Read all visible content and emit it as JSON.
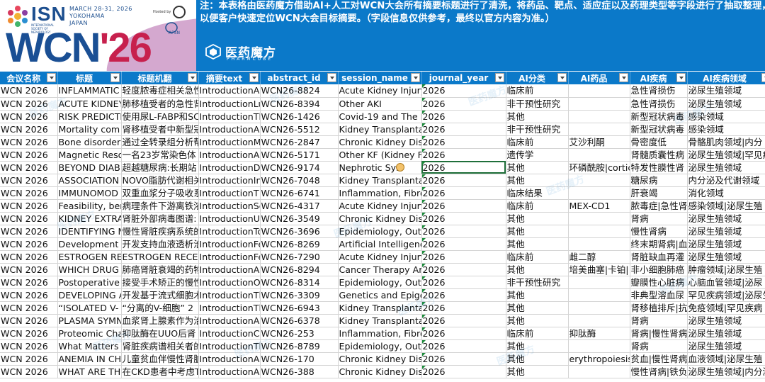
{
  "banner": {
    "isn": "ISN",
    "isn_sub": "INTERNATIONAL SOCIETY OF NEPHROLOGY",
    "event_info": "MARCH 28-31, 2026\nYOKOHAMA\nJAPAN",
    "hosted_by": "Hosted by",
    "host_org": "APSN",
    "wcn": "WCN",
    "wcn_year": "'26",
    "brand_name": "医药魔方",
    "brand_sub": "PHARMCUBE",
    "notice_line1": "注：本表格由医药魔方借助AI+人工对WCN大会所有摘要标题进行了清洗，将药品、靶点、适应症以及药理类型等字段进行了抽取整理，",
    "notice_line2": "以便客户快速定位WCN大会目标摘要。（字段信息仅供参考，最终以官方内容为准。）",
    "watermark": "医药魔方"
  },
  "sheet": {
    "columns": [
      "会议名称",
      "标题",
      "标题机翻",
      "摘要text",
      "abstract_id",
      "session_name",
      "journal_year",
      "AI分类",
      "AI药品",
      "AI疾病",
      "AI疾病领域"
    ],
    "rows": [
      [
        "WCN 2026",
        "INFLAMMATIC",
        "轻度脓毒症相关急性",
        "IntroductionA",
        "WCN26-8824",
        "Acute Kidney Injury",
        "2026",
        "临床前",
        "",
        "急性肾损伤",
        "泌尿生殖领域"
      ],
      [
        "WCN 2026",
        "ACUTE KIDNEY",
        "肺移植受者的急性肾",
        "IntroductionLu",
        "WCN26-8394",
        "Other AKI",
        "2026",
        "非干预性研究",
        "",
        "急性肾损伤",
        "泌尿生殖领域"
      ],
      [
        "WCN 2026",
        "RISK PREDICTI",
        "使用尿L-FABP和SC",
        "IntroductionTh",
        "WCN26-1426",
        "Covid-19 and The K",
        "2026",
        "其他",
        "",
        "新型冠状病毒",
        "感染领域"
      ],
      [
        "WCN 2026",
        "Mortality com",
        "肾移植受者中新型冠",
        "IntroductionA",
        "WCN26-5512",
        "Kidney Transplanta",
        "2026",
        "非干预性研究",
        "",
        "新型冠状病毒",
        "感染领域"
      ],
      [
        "WCN 2026",
        "Bone disorders",
        "通过全转录组分析帮",
        "IntroductionM",
        "WCN26-2847",
        "Chronic Kidney Dis",
        "2026",
        "临床前",
        "艾沙利酮",
        "骨密度低",
        "骨骼肌肉领域|内分"
      ],
      [
        "WCN 2026",
        "Magnetic Reso",
        "一名23岁常染色体",
        "IntroductionA",
        "WCN26-5171",
        "Other KF (Kidney Fa",
        "2026",
        "遗传学",
        "",
        "肾髓质囊性病",
        "泌尿生殖领域|罕见病"
      ],
      [
        "WCN 2026",
        "BEYOND DIAB",
        "超越糖尿病:长期站",
        "IntroductionD",
        "WCN26-9174",
        "Nephrotic Syn",
        "2026",
        "其他",
        "环磷酰胺|cortic",
        "特发性膜性肾",
        "泌尿生殖领域"
      ],
      [
        "WCN 2026",
        "ASSOCIATION",
        "NOVO脂肪代谢相关",
        "IntroductionIn",
        "WCN26-7048",
        "Kidney Transplanta",
        "2026",
        "其他",
        "",
        "糖尿病",
        "内分泌及代谢领域"
      ],
      [
        "WCN 2026",
        "IMMUNOMOD",
        "双重血浆分子吸收系",
        "IntroductionT",
        "WCN26-6741",
        "Inflammation, Fibro",
        "2026",
        "临床结果",
        "",
        "肝衰竭",
        "消化领域"
      ],
      [
        "WCN 2026",
        "Feasibility, ber",
        "病理条件下游离铁浓",
        "IntroductionSe",
        "WCN26-4317",
        "Acute Kidney Injury",
        "2026",
        "临床前",
        "MEX-CD1",
        "脓毒症|急性肾",
        "感染领域|泌尿生殖"
      ],
      [
        "WCN 2026",
        "KIDNEY EXTRA",
        "肾脏外部病毒图谱:",
        "IntroductionU",
        "WCN26-3549",
        "Chronic Kidney Dis",
        "2026",
        "其他",
        "",
        "肾病",
        "泌尿生殖领域"
      ],
      [
        "WCN 2026",
        "IDENTIFYING N",
        "慢性肾脏疾病系统的",
        "IntroductionTc",
        "WCN26-3696",
        "Epidemiology, Outc",
        "2026",
        "其他",
        "",
        "慢性肾病",
        "泌尿生殖领域"
      ],
      [
        "WCN 2026",
        "Development c",
        "开发支持血液透析治",
        "IntroductionFe",
        "WCN26-8269",
        "Artificial Intelligenc",
        "2026",
        "其他",
        "",
        "终末期肾病|血",
        "泌尿生殖领域"
      ],
      [
        "WCN 2026",
        "ESTROGEN RE",
        "ESTROGEN RECEP",
        "IntroductionFe",
        "WCN26-7290",
        "Acute Kidney Injury",
        "2026",
        "临床前",
        "雌二醇",
        "肾脏缺血再灌",
        "泌尿生殖领域"
      ],
      [
        "WCN 2026",
        "WHICH DRUG",
        "肺癌肾脏衰竭的药物",
        "IntroductionA",
        "WCN26-8294",
        "Cancer Therapy An",
        "2026",
        "其他",
        "培美曲塞|卡铂|",
        "非小细胞肺癌",
        "肿瘤领域|泌尿生殖"
      ],
      [
        "WCN 2026",
        "Postoperative",
        "接受手术矫正的慢性",
        "IntroductionO",
        "WCN26-8314",
        "Epidemiology, Outc",
        "2026",
        "非干预性研究",
        "",
        "瓣膜性心脏病",
        "心脑血管领域|泌尿"
      ],
      [
        "WCN 2026",
        "DEVELOPING A",
        "开发基于流式细胞术",
        "IntroductionTl",
        "WCN26-3309",
        "Genetics and Epige",
        "2026",
        "其他",
        "",
        "非典型溶血尿",
        "罕见疾病领域|泌尿生"
      ],
      [
        "WCN 2026",
        "“ISOLATED V-",
        "“分离的V-细胞” 2",
        "IntroductionTl",
        "WCN26-6943",
        "Kidney Transplanta",
        "2026",
        "其他",
        "",
        "肾移植排斥|抗",
        "免疫领域|罕见疾病"
      ],
      [
        "WCN 2026",
        "PLASMA SYMN",
        "血浆肾上腺素作为治",
        "IntroductionA",
        "WCN26-6378",
        "Kidney Transplanta",
        "2026",
        "其他",
        "",
        "肾病",
        "泌尿生殖领域"
      ],
      [
        "WCN 2026",
        "Proteomic Cha",
        "抑肽酶在UUO后肾",
        "IntroductionCl",
        "WCN26-253",
        "Inflammation, Fibro",
        "2026",
        "临床前",
        "抑肽酶",
        "肾病|慢性肾病",
        "泌尿生殖领域"
      ],
      [
        "WCN 2026",
        "What Matters I",
        "肾脏疾病谱相关者的",
        "IntroductionTh",
        "WCN26-8789",
        "Epidemiology, Outc",
        "2026",
        "其他",
        "",
        "肾病",
        "泌尿生殖领域"
      ],
      [
        "WCN 2026",
        "ANEMIA IN CH",
        "儿童贫血伴慢性肾脏",
        "IntroductionA",
        "WCN26-170",
        "Chronic Kidney Dis",
        "2026",
        "其他",
        "erythropoiesis",
        "贫血|慢性肾病",
        "血液领域|泌尿生殖"
      ],
      [
        "WCN 2026",
        "WHAT ARE TH",
        "在CKD患者中考虑T",
        "IntroductionA",
        "WCN26-388",
        "Chronic Kidney Dis",
        "2026",
        "其他",
        "",
        "慢性肾病|铁负",
        "泌尿生殖领域|内分泌"
      ]
    ]
  },
  "colors": {
    "header_blue": "#0b79c9",
    "wcn_navy": "#1a4f94",
    "wcn_red": "#c7204d",
    "selected_border": "#1f6f3a"
  }
}
